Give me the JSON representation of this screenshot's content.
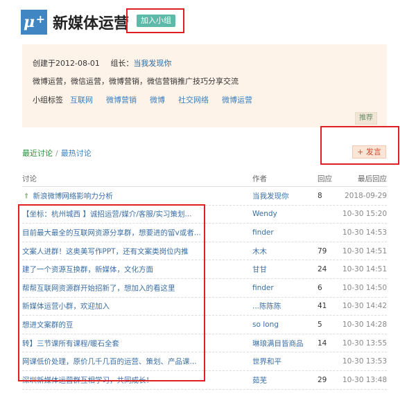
{
  "header": {
    "logo_text": "μ",
    "logo_sup": "+",
    "group_name": "新媒体运营",
    "join_label": "加入小组"
  },
  "info": {
    "created": "创建于2012-08-01",
    "leader_label": "组长：",
    "leader_name": "当我发现你",
    "description": "微博运营，微信运营，微博营销，微信营销推广技巧分享交流",
    "tags_label": "小组标签",
    "tags": [
      "互联网",
      "微博营销",
      "微博",
      "社交网络",
      "微博运营"
    ],
    "recommend_label": "推荐"
  },
  "tabs": {
    "latest": "最近讨论",
    "separator": "/",
    "hottest": "最热讨论"
  },
  "post_label": "+ 发言",
  "table": {
    "headers": {
      "topic": "讨论",
      "author": "作者",
      "replies": "回应",
      "last": "最后回应"
    },
    "rows": [
      {
        "topic": "新浪微博网络影响力分析",
        "author": "当我发现你",
        "replies": "8",
        "last": "2018-09-29",
        "pinned": true
      },
      {
        "topic": "【坐标：杭州城西 】诚招运营/媒介/客服/实习策划...",
        "author": "Wendy",
        "replies": "",
        "last": "10-30 15:20"
      },
      {
        "topic": "目前最大最全的互联网资源分享群，想要进的留v或者...",
        "author": "finder",
        "replies": "",
        "last": "10-30 14:53"
      },
      {
        "topic": "文案人进群！这奥美写作PPT，还有文案类岗位内推",
        "author": "木木",
        "replies": "79",
        "last": "10-30 14:51"
      },
      {
        "topic": "建了一个资源互换群，新媒体，文化方面",
        "author": "甘甘",
        "replies": "24",
        "last": "10-30 14:51"
      },
      {
        "topic": "帮帮互联网资源群开始招新了，想加入的看这里",
        "author": "finder",
        "replies": "6",
        "last": "10-30 14:50"
      },
      {
        "topic": "新媒体运营小群，欢迎加入",
        "author": "...陈陈陈",
        "replies": "41",
        "last": "10-30 14:42"
      },
      {
        "topic": "想进文案群的豆",
        "author": "so long",
        "replies": "5",
        "last": "10-30 14:28"
      },
      {
        "topic": "转】三节课所有课程/暖石全套",
        "author": "琳琅满目皆商品",
        "replies": "14",
        "last": "10-30 13:55"
      },
      {
        "topic": "网课低价处理，原价几千几百的运营、策划、产品课...",
        "author": "世界和平",
        "replies": "",
        "last": "10-30 13:53"
      },
      {
        "topic": "深圳新媒体运营群互相学习，共同成长！",
        "author": "茹芜",
        "replies": "29",
        "last": "10-30 13:48"
      }
    ]
  },
  "colors": {
    "accent_green": "#5dbaa8",
    "link_blue": "#3a6ea5",
    "highlight_red": "#e02020",
    "info_bg": "#fdf3e8"
  }
}
